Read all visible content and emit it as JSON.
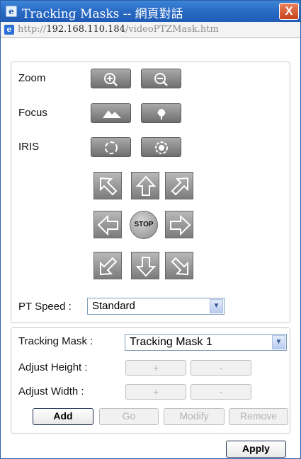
{
  "window": {
    "title": "Tracking Masks -- 網頁對話",
    "close_label": "X",
    "title_icon": "ie-page-icon"
  },
  "address": {
    "prefix": "http://",
    "host": "192.168.110.184",
    "path": "/videoPTZMask.htm"
  },
  "ptz": {
    "zoom_label": "Zoom",
    "focus_label": "Focus",
    "iris_label": "IRIS",
    "stop_label": "STOP",
    "speed_label": "PT Speed :",
    "speed_value": "Standard"
  },
  "mask": {
    "tracking_label": "Tracking Mask :",
    "tracking_value": "Tracking Mask 1",
    "height_label": "Adjust Height :",
    "width_label": "Adjust Width :",
    "plus": "+",
    "minus": "-",
    "add_label": "Add",
    "go_label": "Go",
    "modify_label": "Modify",
    "remove_label": "Remove"
  },
  "footer": {
    "apply_label": "Apply"
  },
  "colors": {
    "title_bar": "#2a6cc6",
    "close_button": "#c8401c",
    "button_gray": "#7b7b7b"
  }
}
